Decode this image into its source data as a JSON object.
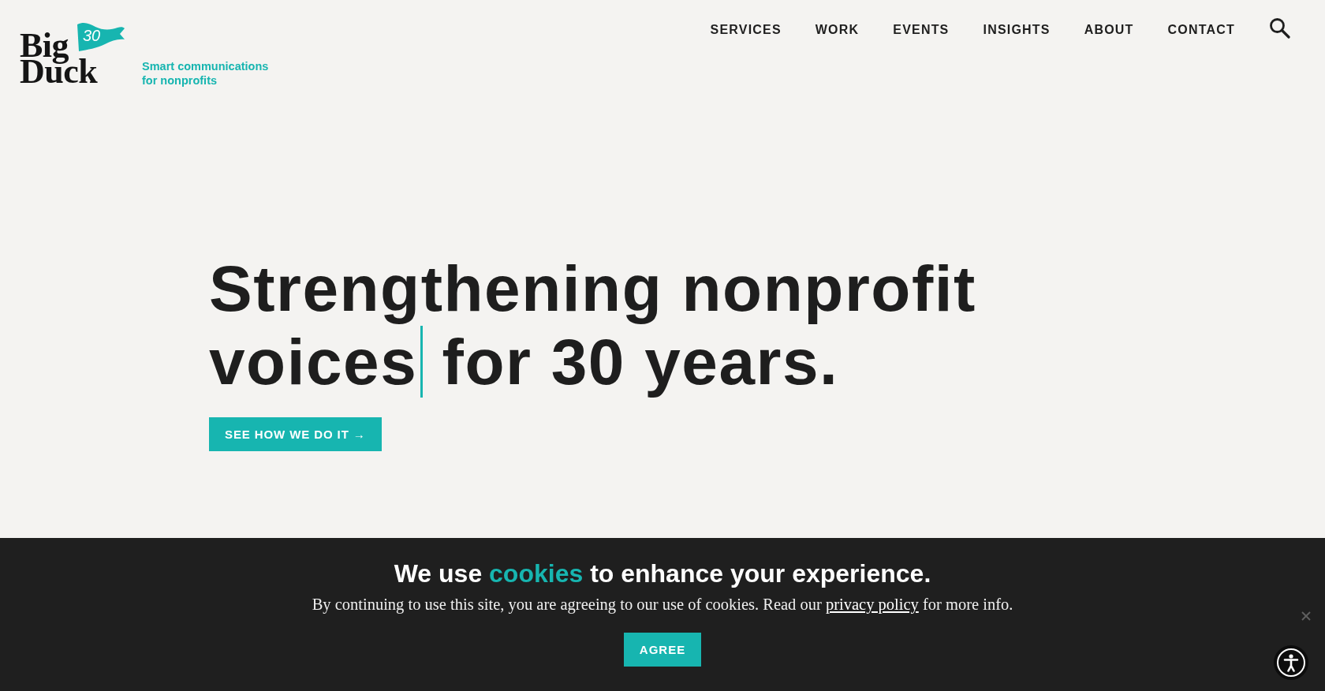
{
  "header": {
    "logo": {
      "wordmark_lines": [
        "Big",
        "Duck"
      ],
      "flag_text": "30"
    },
    "tagline": "Smart communications for nonprofits",
    "nav": [
      "SERVICES",
      "WORK",
      "EVENTS",
      "INSIGHTS",
      "ABOUT",
      "CONTACT"
    ]
  },
  "hero": {
    "heading": {
      "before_cursor": "Strengthening nonprofit voices",
      "after_cursor": "for 30 years.",
      "cursor_shown": true
    },
    "button": "SEE HOW WE DO IT →"
  },
  "cookie_banner": {
    "heading": {
      "before": "We use",
      "highlight": "cookies",
      "after": "to enhance your experience."
    },
    "message": {
      "before_link": "By continuing to use this site, you are agreeing to our use of cookies. Read our",
      "link": "privacy policy",
      "after_link": "for more info."
    },
    "button": "AGREE"
  }
}
